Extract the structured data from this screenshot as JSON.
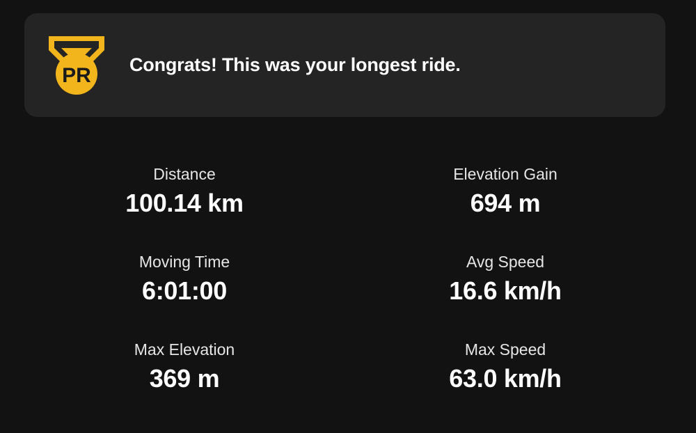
{
  "banner": {
    "icon": "pr-medal-icon",
    "badge_text": "PR",
    "message": "Congrats! This was your longest ride.",
    "accent_color": "#F2B51C",
    "background_color": "#242424"
  },
  "stats": [
    {
      "label": "Distance",
      "value": "100.14 km"
    },
    {
      "label": "Elevation Gain",
      "value": "694 m"
    },
    {
      "label": "Moving Time",
      "value": "6:01:00"
    },
    {
      "label": "Avg Speed",
      "value": "16.6 km/h"
    },
    {
      "label": "Max Elevation",
      "value": "369 m"
    },
    {
      "label": "Max Speed",
      "value": "63.0 km/h"
    }
  ]
}
